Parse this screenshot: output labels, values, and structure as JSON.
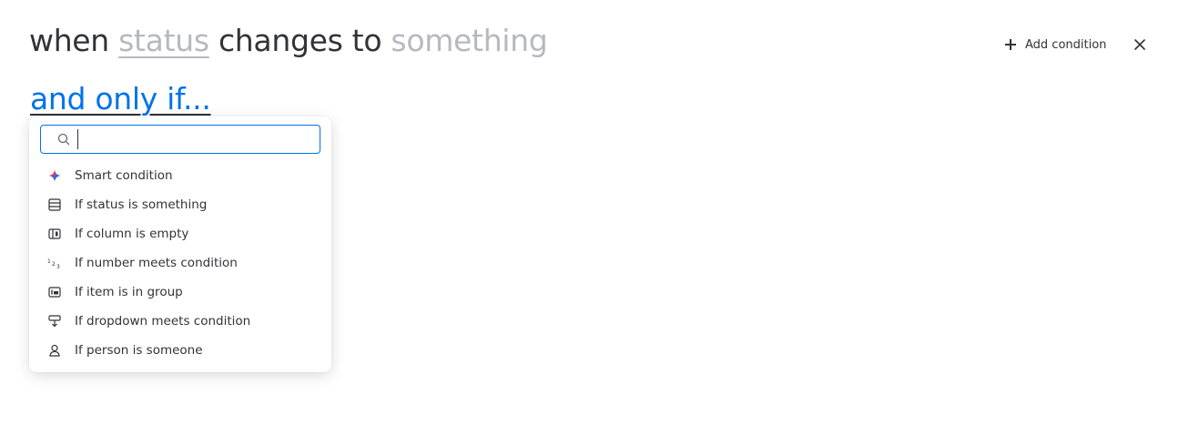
{
  "sentence": {
    "when": "when",
    "trigger_column": "status",
    "changes_to": "changes to",
    "trigger_value": "something"
  },
  "qualifier": "and only if...",
  "actions": {
    "add_condition_label": "Add condition"
  },
  "dropdown": {
    "search": {
      "value": "",
      "placeholder": ""
    },
    "options": [
      {
        "label": "Smart condition",
        "icon": "sparkle-icon"
      },
      {
        "label": "If status is something",
        "icon": "status-column-icon"
      },
      {
        "label": "If column is empty",
        "icon": "column-icon"
      },
      {
        "label": "If number meets condition",
        "icon": "numbers-icon"
      },
      {
        "label": "If item is in group",
        "icon": "group-icon"
      },
      {
        "label": "If dropdown meets condition",
        "icon": "dropdown-column-icon"
      },
      {
        "label": "If person is someone",
        "icon": "person-icon"
      }
    ]
  },
  "colors": {
    "accent": "#0073ea",
    "text": "#323338",
    "muted": "#b7b8c0"
  }
}
